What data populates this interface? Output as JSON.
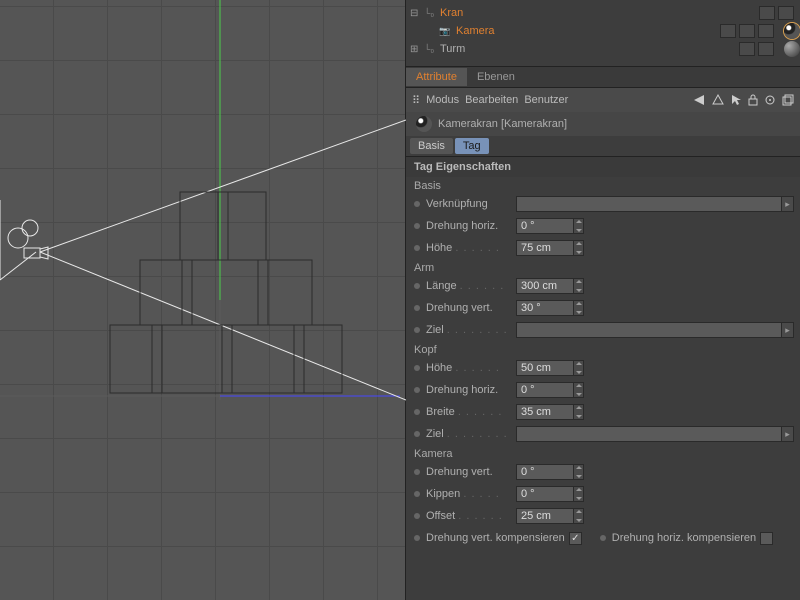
{
  "hierarchy": {
    "items": [
      {
        "label": "Kran",
        "indent": 0,
        "toggle": "⊟"
      },
      {
        "label": "Kamera",
        "indent": 1,
        "toggle": ""
      },
      {
        "label": "Turm",
        "indent": 0,
        "toggle": "⊞"
      }
    ]
  },
  "tabs": {
    "attribute": "Attribute",
    "ebenen": "Ebenen"
  },
  "attr_menu": {
    "modus": "Modus",
    "bearbeiten": "Bearbeiten",
    "benutzer": "Benutzer"
  },
  "object_header": "Kamerakran [Kamerakran]",
  "subtabs": {
    "basis": "Basis",
    "tag": "Tag"
  },
  "section_title": "Tag Eigenschaften",
  "groups": {
    "basis": "Basis",
    "arm": "Arm",
    "kopf": "Kopf",
    "kamera": "Kamera"
  },
  "props": {
    "verknuepfung": "Verknüpfung",
    "drehung_horiz": "Drehung horiz.",
    "hoehe": "Höhe",
    "laenge": "Länge",
    "drehung_vert": "Drehung vert.",
    "ziel": "Ziel",
    "breite": "Breite",
    "kippen": "Kippen",
    "offset": "Offset",
    "dreh_vert_komp": "Drehung vert. kompensieren",
    "dreh_horiz_komp": "Drehung horiz. kompensieren"
  },
  "values": {
    "basis_drehung_horiz": "0 °",
    "basis_hoehe": "75 cm",
    "arm_laenge": "300 cm",
    "arm_drehung_vert": "30 °",
    "kopf_hoehe": "50 cm",
    "kopf_drehung_horiz": "0 °",
    "kopf_breite": "35 cm",
    "kam_drehung_vert": "0 °",
    "kam_kippen": "0 °",
    "kam_offset": "25 cm",
    "kam_vert_komp": true,
    "kam_horiz_komp": false
  }
}
